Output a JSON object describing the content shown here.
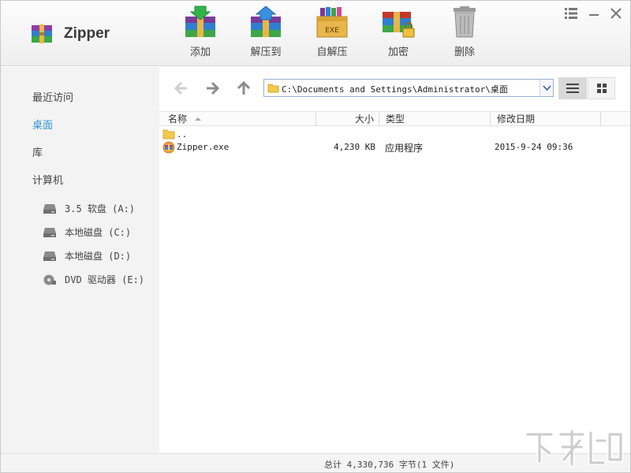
{
  "app": {
    "title": "Zipper"
  },
  "toolbar": {
    "add_label": "添加",
    "extract_label": "解压到",
    "sfx_label": "自解压",
    "encrypt_label": "加密",
    "delete_label": "删除",
    "sfx_badge": "EXE"
  },
  "sidebar": {
    "recent": "最近访问",
    "desktop": "桌面",
    "library": "库",
    "computer": "计算机",
    "drives": [
      {
        "label": "3.5 软盘 (A:)",
        "icon": "floppy-drive-icon"
      },
      {
        "label": "本地磁盘 (C:)",
        "icon": "hard-drive-icon"
      },
      {
        "label": "本地磁盘 (D:)",
        "icon": "hard-drive-icon"
      },
      {
        "label": "DVD 驱动器 (E:)",
        "icon": "dvd-drive-icon"
      }
    ]
  },
  "navigation": {
    "path": "C:\\Documents and Settings\\Administrator\\桌面"
  },
  "columns": {
    "name": "名称",
    "size": "大小",
    "type": "类型",
    "modified": "修改日期"
  },
  "files": [
    {
      "name": "..",
      "size": "",
      "type": "",
      "modified": "",
      "icon": "folder-icon"
    },
    {
      "name": "Zipper.exe",
      "size": "4,230 KB",
      "type": "应用程序",
      "modified": "2015-9-24 09:36",
      "icon": "zipper-app-icon"
    }
  ],
  "status": {
    "summary": "总计  4,330,736 字节(1 文件)"
  },
  "colors": {
    "accent": "#2f94d6",
    "sidebar_bg": "#f3f3f3",
    "toolbar_bg": "#eeeeee"
  }
}
